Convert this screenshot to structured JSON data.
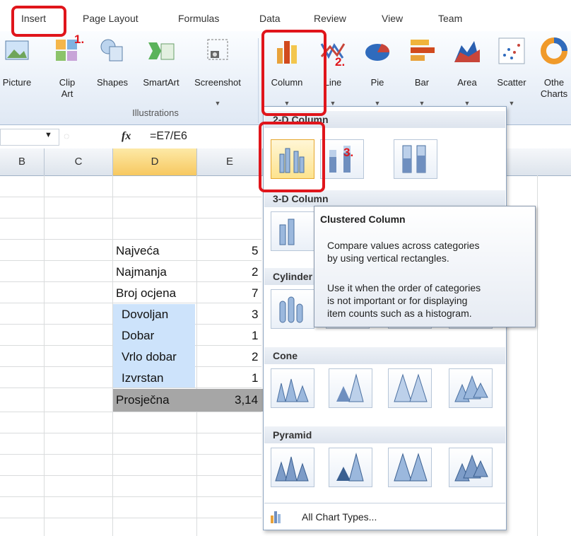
{
  "ribbon": {
    "tabs": [
      "Insert",
      "Page Layout",
      "Formulas",
      "Data",
      "Review",
      "View",
      "Team"
    ],
    "buttons": {
      "picture": "Picture",
      "clip_art_1": "Clip",
      "clip_art_2": "Art",
      "shapes": "Shapes",
      "smartart": "SmartArt",
      "screenshot": "Screenshot",
      "column": "Column",
      "line": "Line",
      "pie": "Pie",
      "bar": "Bar",
      "area": "Area",
      "scatter": "Scatter",
      "other_charts_1": "Othe",
      "other_charts_2": "Charts"
    },
    "group_label": "Illustrations"
  },
  "formula_bar": {
    "fx": "fx",
    "formula": "=E7/E6"
  },
  "columns": [
    "B",
    "C",
    "D",
    "E"
  ],
  "rows": [
    {
      "label": "Najveća",
      "value": "5"
    },
    {
      "label": "Najmanja",
      "value": "2"
    },
    {
      "label": "Broj ocjena",
      "value": "7"
    },
    {
      "label": "Dovoljan",
      "value": "3"
    },
    {
      "label": "Dobar",
      "value": "1"
    },
    {
      "label": "Vrlo dobar",
      "value": "2"
    },
    {
      "label": "Izvrstan",
      "value": "1"
    },
    {
      "label": "Prosječna",
      "value": "3,14"
    }
  ],
  "menu": {
    "sections": [
      "2-D Column",
      "3-D Column",
      "Cylinder",
      "Cone",
      "Pyramid"
    ],
    "all_chart_types": "All Chart Types..."
  },
  "tooltip": {
    "title": "Clustered Column",
    "line1": "Compare values across categories",
    "line2": "by using vertical rectangles.",
    "line3": "Use it when the order of categories",
    "line4": "is not important or for displaying",
    "line5": "item counts such as a histogram."
  },
  "annotations": {
    "step1": "1.",
    "step2": "2.",
    "step3": "3."
  },
  "colors": {
    "highlight": "#e0151b",
    "selected_col": "#fde38e",
    "cell_blue": "#cde3fb",
    "cell_gray": "#a6a6a6"
  }
}
